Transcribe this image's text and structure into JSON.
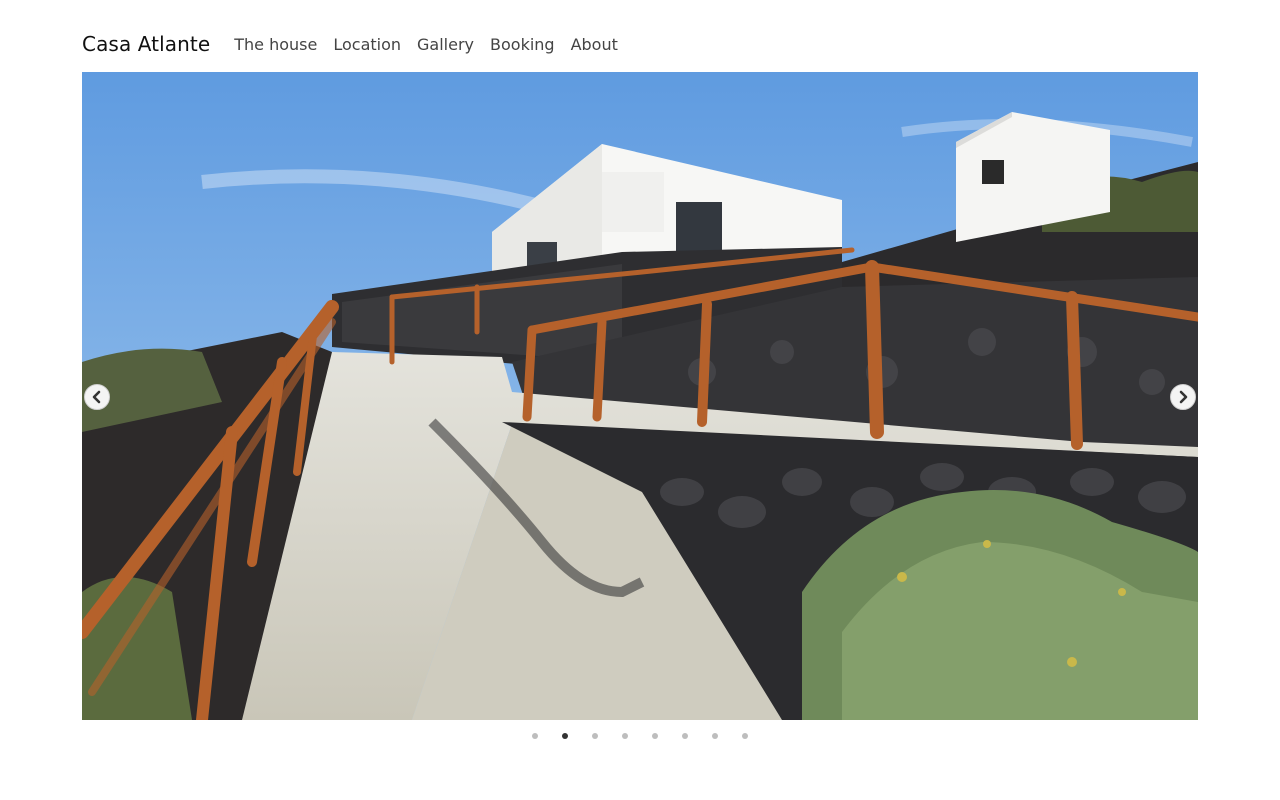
{
  "header": {
    "brand": "Casa Atlante",
    "nav": [
      {
        "label": "The house"
      },
      {
        "label": "Location"
      },
      {
        "label": "Gallery"
      },
      {
        "label": "Booking"
      },
      {
        "label": "About"
      }
    ]
  },
  "carousel": {
    "slide_count": 8,
    "active_index": 1,
    "prev_icon": "chevron-left-icon",
    "next_icon": "chevron-right-icon"
  },
  "colors": {
    "sky": "#6fa6e0",
    "wall": "#ffffff",
    "stone": "#2f2f33",
    "railing": "#b5612b",
    "concrete": "#d9d7cf",
    "dot_inactive": "#bdbdbd",
    "dot_active": "#333333"
  }
}
